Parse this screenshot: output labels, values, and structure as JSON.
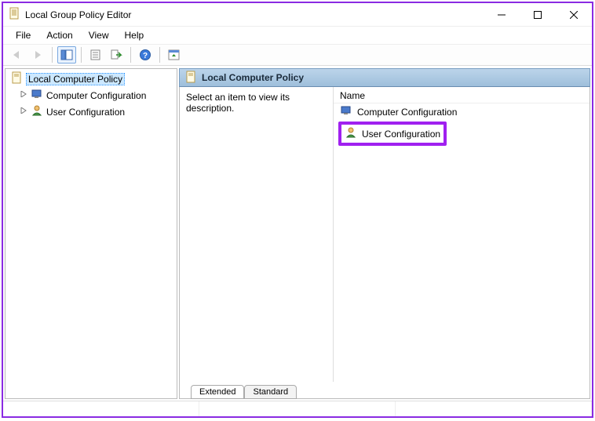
{
  "window": {
    "title": "Local Group Policy Editor"
  },
  "menus": [
    "File",
    "Action",
    "View",
    "Help"
  ],
  "toolbar_icons": [
    "back",
    "forward",
    "up",
    "show-tree",
    "properties",
    "export-list",
    "help",
    "show-pane"
  ],
  "tree": {
    "root": {
      "label": "Local Computer Policy",
      "selected": true
    },
    "children": [
      {
        "label": "Computer Configuration"
      },
      {
        "label": "User Configuration"
      }
    ]
  },
  "detail": {
    "header": "Local Computer Policy",
    "description_prompt": "Select an item to view its description.",
    "column_header": "Name",
    "items": [
      {
        "label": "Computer Configuration"
      },
      {
        "label": "User Configuration",
        "highlighted": true
      }
    ],
    "tabs": [
      {
        "label": "Extended",
        "active": true
      },
      {
        "label": "Standard",
        "active": false
      }
    ]
  }
}
